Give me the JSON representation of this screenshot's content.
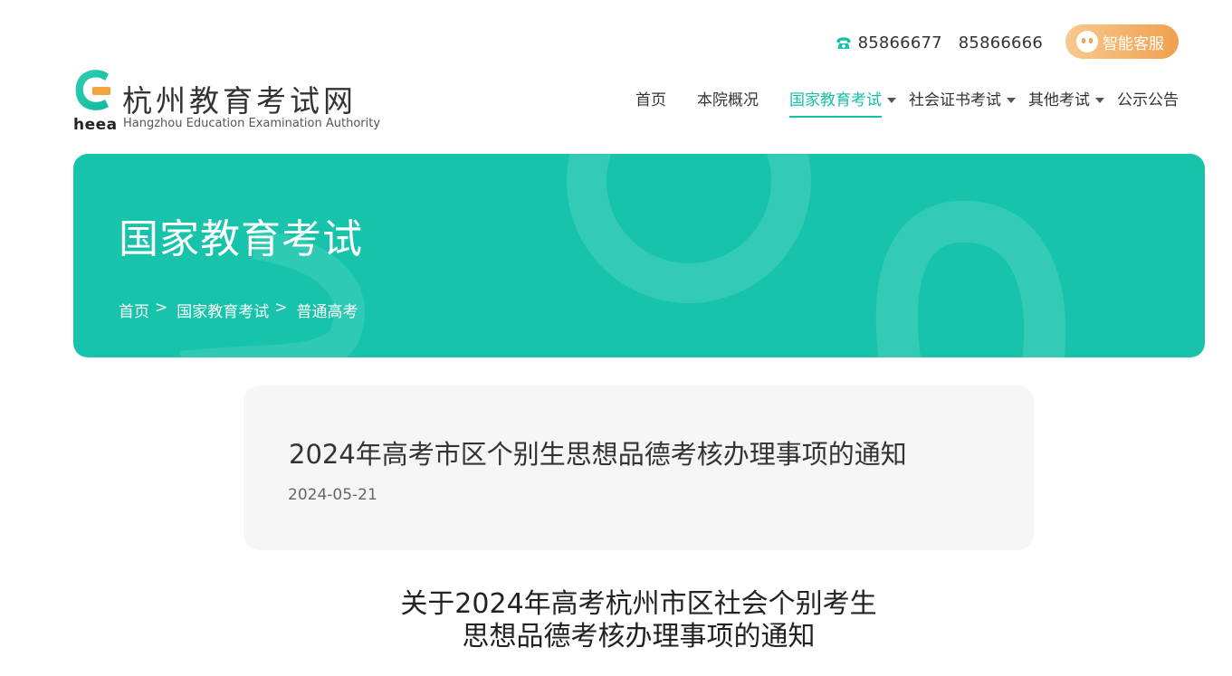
{
  "topbar": {
    "phones": [
      "85866677",
      "85866666"
    ],
    "service_label": "智能客服",
    "accent_color": "#15bfa7"
  },
  "logo": {
    "cn_name": "杭州教育考试网",
    "abbr": "heea",
    "en_name": "Hangzhou Education Examination Authority"
  },
  "nav": {
    "items": [
      {
        "label": "首页",
        "dropdown": false,
        "active": false
      },
      {
        "label": "本院概况",
        "dropdown": false,
        "active": false
      },
      {
        "label": "国家教育考试",
        "dropdown": true,
        "active": true
      },
      {
        "label": "社会证书考试",
        "dropdown": true,
        "active": false
      },
      {
        "label": "其他考试",
        "dropdown": true,
        "active": false
      },
      {
        "label": "公示公告",
        "dropdown": false,
        "active": false
      }
    ]
  },
  "banner": {
    "title": "国家教育考试",
    "background_color": "#17c4ab",
    "breadcrumb": [
      "首页",
      "国家教育考试",
      "普通高考"
    ],
    "separator": ">"
  },
  "article": {
    "title": "2024年高考市区个别生思想品德考核办理事项的通知",
    "date": "2024-05-21",
    "heading_lines": [
      "关于2024年高考杭州市区社会个别考生",
      "思想品德考核办理事项的通知"
    ]
  },
  "icons": {
    "phone": "phone-icon",
    "service": "robot-face-icon",
    "caret": "caret-down-icon"
  }
}
